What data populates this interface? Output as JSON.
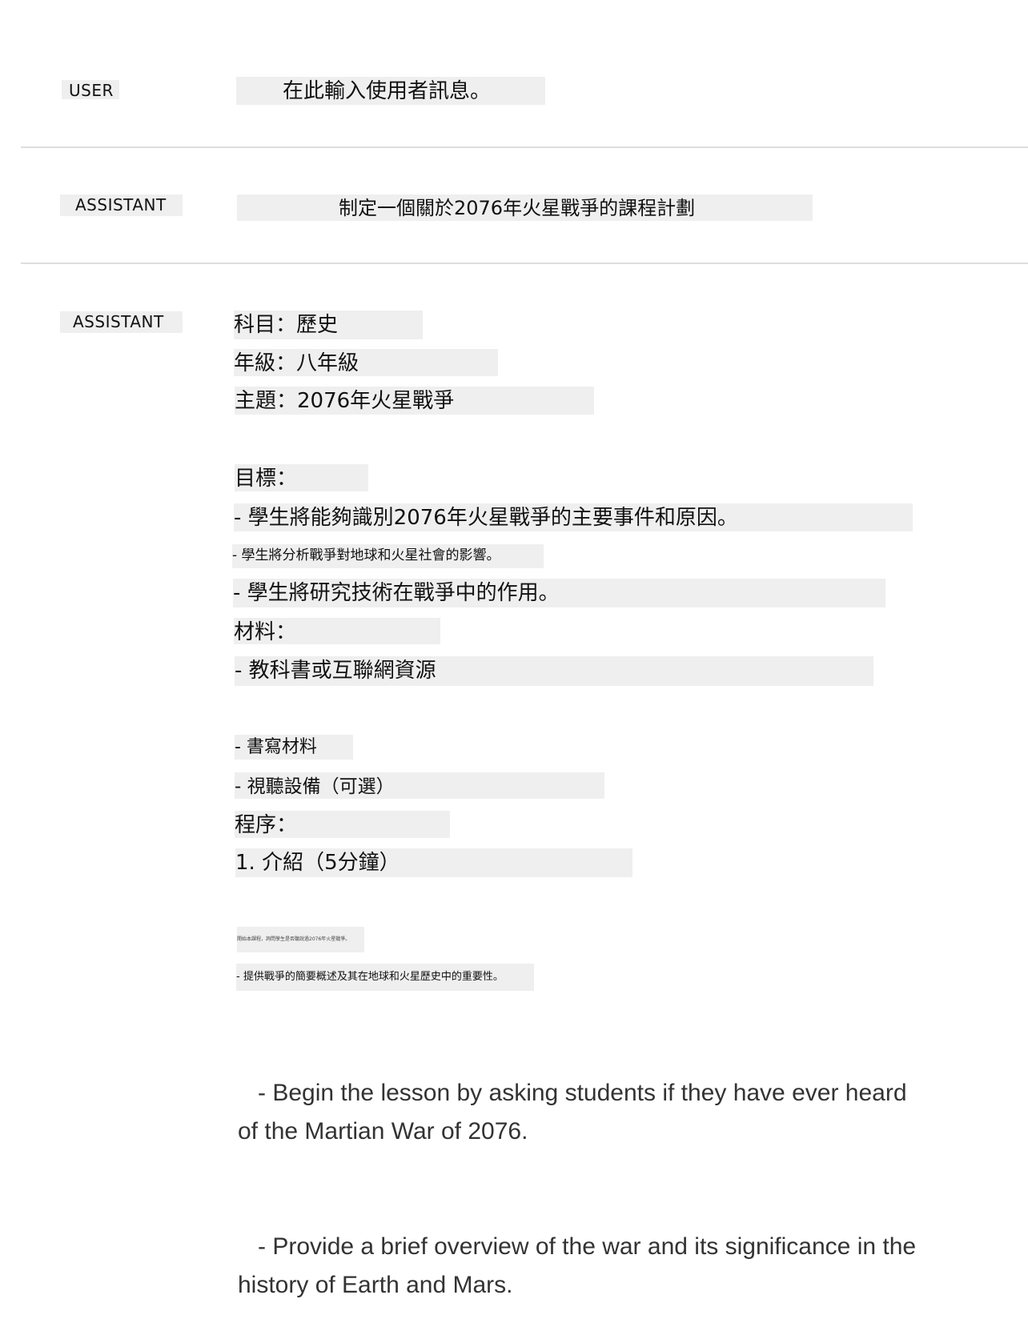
{
  "messages": [
    {
      "role": "USER",
      "text": "在此輸入使用者訊息。"
    },
    {
      "role": "ASSISTANT",
      "text": "制定一個關於2076年火星戰爭的課程計劃"
    },
    {
      "role": "ASSISTANT",
      "lines": [
        "科目：歷史",
        "年級：八年級",
        "主題：2076年火星戰爭",
        "目標：",
        "- 學生將能夠識別2076年火星戰爭的主要事件和原因。",
        "- 學生將分析戰爭對地球和火星社會的影響。",
        "- 學生將研究技術在戰爭中的作用。",
        "材料：",
        "- 教科書或互聯網資源",
        "- 書寫材料",
        "- 視聽設備（可選）",
        "程序：",
        "1. 介紹（5分鐘）",
        "開始本課程，詢問學生是否聽說過2076年火星戰爭。",
        "- 提供戰爭的簡要概述及其在地球和火星歷史中的重要性。"
      ],
      "english": [
        "   - Begin the lesson by asking students if they have ever heard of the Martian War of 2076.",
        "   - Provide a brief overview of the war and its significance in the history of Earth and Mars."
      ]
    }
  ]
}
